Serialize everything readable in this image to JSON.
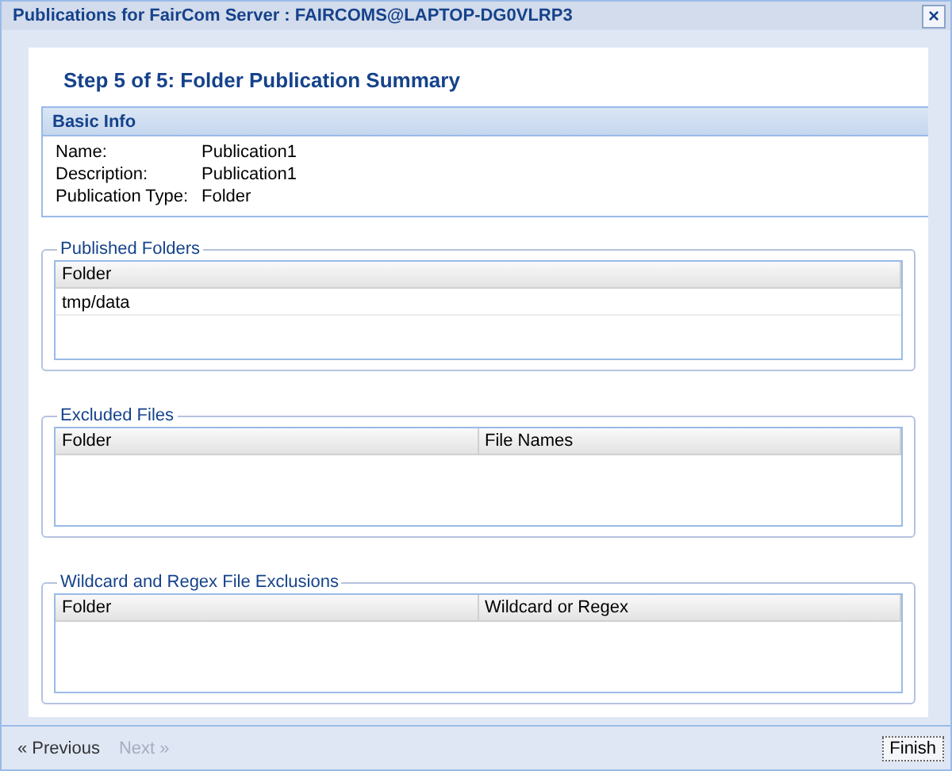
{
  "window": {
    "title": "Publications for FairCom Server : FAIRCOMS@LAPTOP-DG0VLRP3",
    "close": "×"
  },
  "step_title": "Step 5 of 5: Folder Publication Summary",
  "basic_info": {
    "title": "Basic Info",
    "fields": [
      {
        "label": "Name:",
        "value": "Publication1"
      },
      {
        "label": "Description:",
        "value": "Publication1"
      },
      {
        "label": "Publication Type:",
        "value": "Folder"
      }
    ]
  },
  "sections": [
    {
      "title": "Published Folders",
      "columns": [
        "Folder"
      ],
      "rows": [
        [
          "tmp/data"
        ]
      ]
    },
    {
      "title": "Excluded Files",
      "columns": [
        "Folder",
        "File Names"
      ]
    },
    {
      "title": "Wildcard and Regex File Exclusions",
      "columns": [
        "Folder",
        "Wildcard or Regex"
      ]
    }
  ],
  "footer": {
    "buttons": [
      {
        "label": "« Previous",
        "disabled": false
      },
      {
        "label": "Next »",
        "disabled": true
      }
    ],
    "finish": "Finish"
  }
}
